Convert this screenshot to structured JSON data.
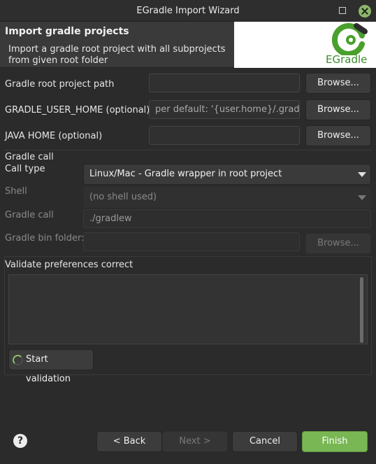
{
  "window": {
    "title": "EGradle Import Wizard"
  },
  "header": {
    "title": "Import gradle projects",
    "description": "Import a gradle root project with all subprojects from given root folder",
    "logo_text": "EGradle"
  },
  "paths": {
    "root_label": "Gradle root project path",
    "root_value": "",
    "gradle_home_label": "GRADLE_USER_HOME (optional)",
    "gradle_home_placeholder": "per default: '{user.home}/.gradle'",
    "java_home_label": "JAVA HOME (optional)",
    "java_home_value": "",
    "browse_label": "Browse..."
  },
  "gradle_call": {
    "group_label": "Gradle call",
    "call_type_label": "Call type",
    "call_type_value": "Linux/Mac - Gradle wrapper in root project",
    "shell_label": "Shell",
    "shell_value": "(no shell used)",
    "gradle_call_label": "Gradle call",
    "gradle_call_value": "./gradlew",
    "bin_folder_label": "Gradle bin folder:",
    "bin_folder_value": "",
    "browse_label": "Browse..."
  },
  "validation": {
    "group_label": "Validate preferences correct",
    "output": "",
    "start_label": "Start validation"
  },
  "footer": {
    "help": "?",
    "back": "< Back",
    "next": "Next >",
    "cancel": "Cancel",
    "finish": "Finish"
  },
  "colors": {
    "accent": "#79b754",
    "background": "#2b2b2b",
    "logo_green": "#3c8c2a"
  }
}
